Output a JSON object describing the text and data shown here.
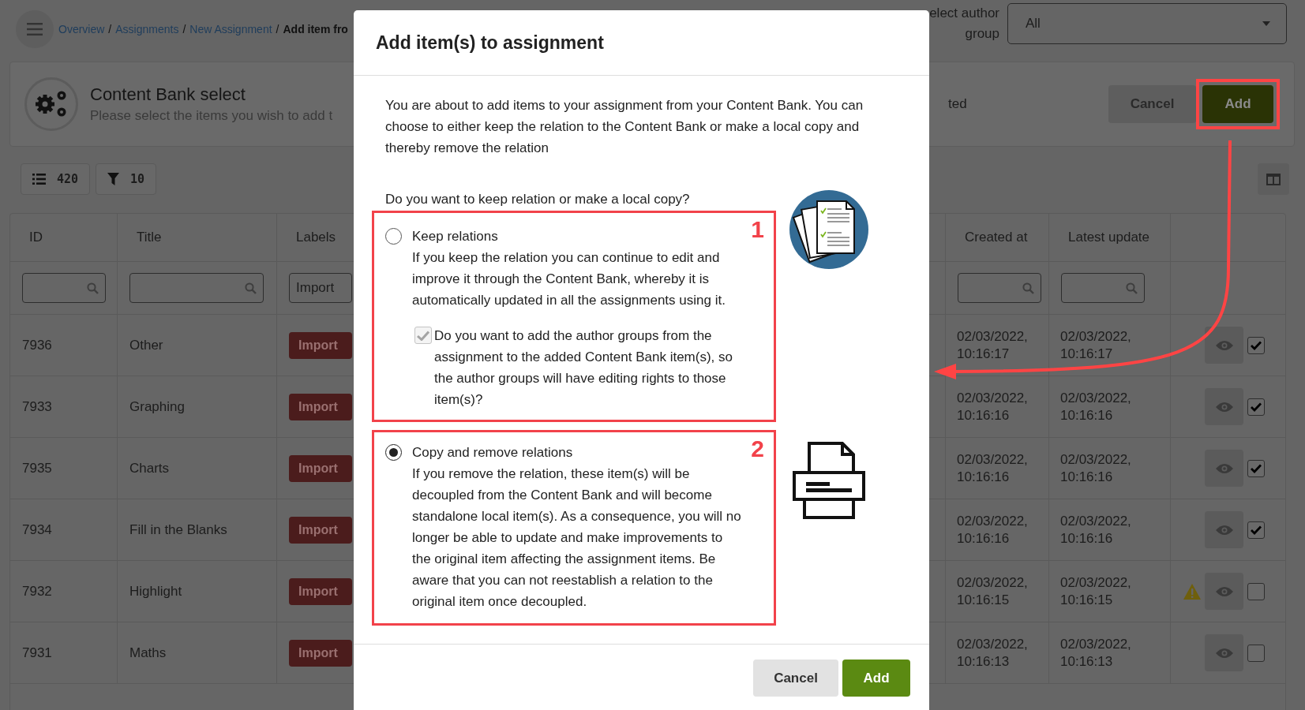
{
  "top_bar": {
    "separator": "/",
    "breadcrumb": [
      {
        "label": "Overview",
        "link": true
      },
      {
        "label": "Assignments",
        "link": true
      },
      {
        "label": "New Assignment",
        "link": true
      },
      {
        "label": "Add item fro",
        "link": false
      }
    ],
    "author_group": {
      "label": "elect author group",
      "value": "All"
    }
  },
  "header": {
    "title": "Content Bank select",
    "subtitle": "Please select the items you wish to add t",
    "selection_text": "ted",
    "buttons": [
      {
        "label": "Cancel",
        "kind": "secondary",
        "highlighted": false
      },
      {
        "label": "Add",
        "kind": "primary",
        "highlighted": true
      }
    ]
  },
  "toolbar": {
    "chips": [
      {
        "kind": "list",
        "count": "420"
      },
      {
        "kind": "filter",
        "count": "10"
      }
    ]
  },
  "table": {
    "columns": [
      "ID",
      "Title",
      "Labels",
      "Created at",
      "Latest update"
    ],
    "label_filter": "Import",
    "rows": [
      {
        "id": "7936",
        "title": "Other",
        "label": "Import",
        "created": "02/03/2022, 10:16:17",
        "updated": "02/03/2022, 10:16:17",
        "warning": false,
        "checked": true
      },
      {
        "id": "7933",
        "title": "Graphing",
        "label": "Import",
        "created": "02/03/2022, 10:16:16",
        "updated": "02/03/2022, 10:16:16",
        "warning": false,
        "checked": true
      },
      {
        "id": "7935",
        "title": "Charts",
        "label": "Import",
        "created": "02/03/2022, 10:16:16",
        "updated": "02/03/2022, 10:16:16",
        "warning": false,
        "checked": true
      },
      {
        "id": "7934",
        "title": "Fill in the Blanks",
        "label": "Import",
        "created": "02/03/2022, 10:16:16",
        "updated": "02/03/2022, 10:16:16",
        "warning": false,
        "checked": true
      },
      {
        "id": "7932",
        "title": "Highlight",
        "label": "Import",
        "created": "02/03/2022, 10:16:15",
        "updated": "02/03/2022, 10:16:15",
        "warning": true,
        "checked": false
      },
      {
        "id": "7931",
        "title": "Maths",
        "label": "Import",
        "created": "02/03/2022, 10:16:13",
        "updated": "02/03/2022, 10:16:13",
        "warning": false,
        "checked": false
      }
    ]
  },
  "dialog": {
    "title": "Add item(s) to assignment",
    "intro": "You are about to add items to your assignment from your Content Bank. You can choose to either keep the relation to the Content Bank or make a local copy and thereby remove the relation",
    "question": "Do you want to keep relation or make a local copy?",
    "options": [
      {
        "label": "Keep relations",
        "selected": false,
        "number": "1",
        "description": "If you keep the relation you can continue to edit and improve it through the Content Bank, whereby it is automatically updated in all the assignments using it.",
        "sub_option": {
          "label": "Do you want to add the author groups from the assignment to the added Content Bank item(s), so the author groups will have editing rights to those item(s)?",
          "checked": true,
          "disabled": true
        }
      },
      {
        "label": "Copy and remove relations",
        "selected": true,
        "number": "2",
        "description": "If you remove the relation, these item(s) will be decoupled from the Content Bank and will become standalone local item(s). As a consequence, you will no longer be able to update and make improvements to the original item affecting the assignment items. Be aware that you can not reestablish a relation to the original item once decoupled."
      }
    ],
    "buttons": [
      {
        "label": "Cancel",
        "kind": "secondary"
      },
      {
        "label": "Add",
        "kind": "primary"
      }
    ]
  }
}
